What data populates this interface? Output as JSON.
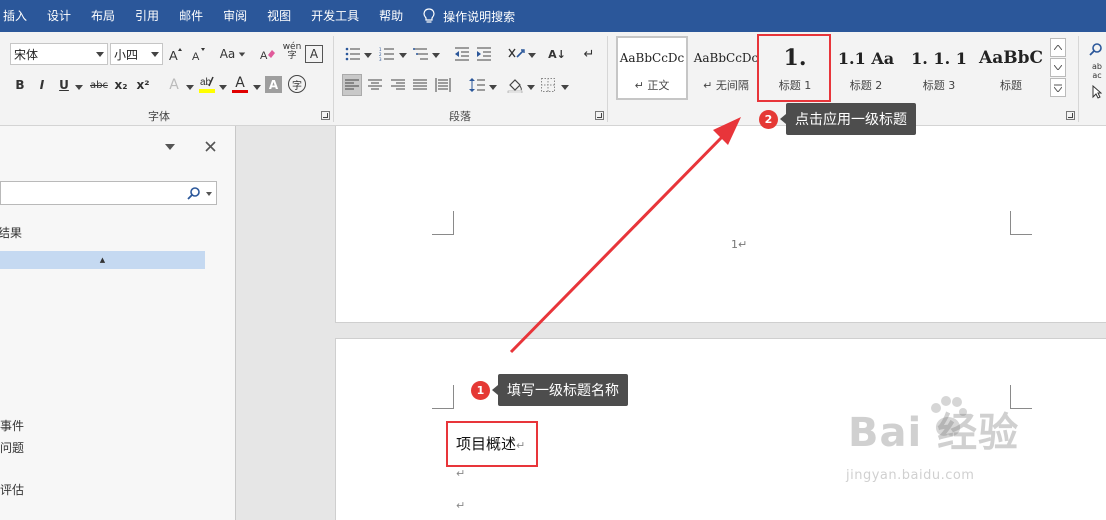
{
  "menubar": {
    "tabs": [
      "插入",
      "设计",
      "布局",
      "引用",
      "邮件",
      "审阅",
      "视图",
      "开发工具",
      "帮助"
    ],
    "tell_me": "操作说明搜索",
    "tell_me_icon": "lightbulb-icon"
  },
  "font_group": {
    "label": "字体",
    "font_name": "宋体",
    "font_size": "小四",
    "change_case": "Aa",
    "phonetic_top": "wén",
    "phonetic_bottom": "字",
    "enclose_char": "A",
    "bold": "B",
    "italic": "I",
    "underline": "U",
    "strikethrough": "abc",
    "subscript": "x₂",
    "superscript": "x²",
    "text_effects": "A",
    "font_color": "A",
    "char_shading": "A",
    "enclose_circle": "字"
  },
  "paragraph_group": {
    "label": "段落",
    "sort": "A↓",
    "mark": "↵"
  },
  "styles_group": {
    "styles": [
      {
        "sample": "AaBbCcDc",
        "name": "正文"
      },
      {
        "sample": "AaBbCcDc",
        "name": "无间隔"
      },
      {
        "sample": "1.",
        "name": "标题 1"
      },
      {
        "sample": "1.1  Aa",
        "name": "标题 2"
      },
      {
        "sample": "1. 1. 1",
        "name": "标题 3"
      },
      {
        "sample": "AaBbC",
        "name": "标题"
      }
    ],
    "para_mark": "↵"
  },
  "editing_group": {
    "find": "ab",
    "replace": "ac"
  },
  "nav_pane": {
    "result_label": "结果",
    "items": [
      "事件",
      "问题",
      "评估"
    ],
    "collapse_glyph": "▲"
  },
  "document": {
    "page_number": "1",
    "para_mark": "↵",
    "heading_text": "项目概述"
  },
  "callouts": [
    {
      "num": "1",
      "text": "填写一级标题名称"
    },
    {
      "num": "2",
      "text": "点击应用一级标题"
    }
  ],
  "watermark": {
    "main": "Bai 经验",
    "sub": "jingyan.baidu.com"
  },
  "colors": {
    "accent": "#2b579a",
    "highlight": "#e8353a",
    "callout_bg": "#4d4d4d",
    "nav_selected": "#c5d9f1"
  }
}
